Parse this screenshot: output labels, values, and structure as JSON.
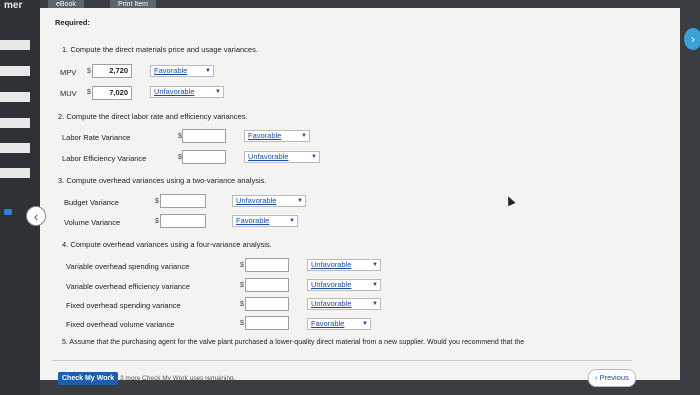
{
  "topbar": {
    "left_label": "mer",
    "tab_ebook": "eBook",
    "tab_print": "Print Item"
  },
  "required": "Required:",
  "q1": {
    "heading": "1. Compute the direct materials price and usage variances.",
    "rows": [
      {
        "label": "MPV",
        "value": "2,720",
        "select": "Favorable"
      },
      {
        "label": "MUV",
        "value": "7,020",
        "select": "Unfavorable"
      }
    ]
  },
  "q2": {
    "heading": "2. Compute the direct labor rate and efficiency variances.",
    "rows": [
      {
        "label": "Labor Rate Variance",
        "value": "",
        "select": "Favorable"
      },
      {
        "label": "Labor Efficiency Variance",
        "value": "",
        "select": "Unfavorable"
      }
    ]
  },
  "q3": {
    "heading": "3. Compute overhead variances using a two-variance analysis.",
    "rows": [
      {
        "label": "Budget Variance",
        "value": "",
        "select": "Unfavorable"
      },
      {
        "label": "Volume Variance",
        "value": "",
        "select": "Favorable"
      }
    ]
  },
  "q4": {
    "heading": "4. Compute overhead variances using a four-variance analysis.",
    "rows": [
      {
        "label": "Variable overhead spending variance",
        "value": "",
        "select": "Unfavorable"
      },
      {
        "label": "Variable overhead efficiency variance",
        "value": "",
        "select": "Unfavorable"
      },
      {
        "label": "Fixed overhead spending variance",
        "value": "",
        "select": "Unfavorable"
      },
      {
        "label": "Fixed overhead volume variance",
        "value": "",
        "select": "Favorable"
      }
    ]
  },
  "q5": {
    "text": "5. Assume that the purchasing agent for the valve plant purchased a lower-quality direct material from a new supplier. Would you recommend that the"
  },
  "footer": {
    "check_label": "Check My Work",
    "remaining": "3 more Check My Work uses remaining.",
    "previous": "Previous"
  },
  "currency": "$",
  "icons": {
    "prev": "chevron-left-icon",
    "next_panel": "chevron-right-icon"
  }
}
